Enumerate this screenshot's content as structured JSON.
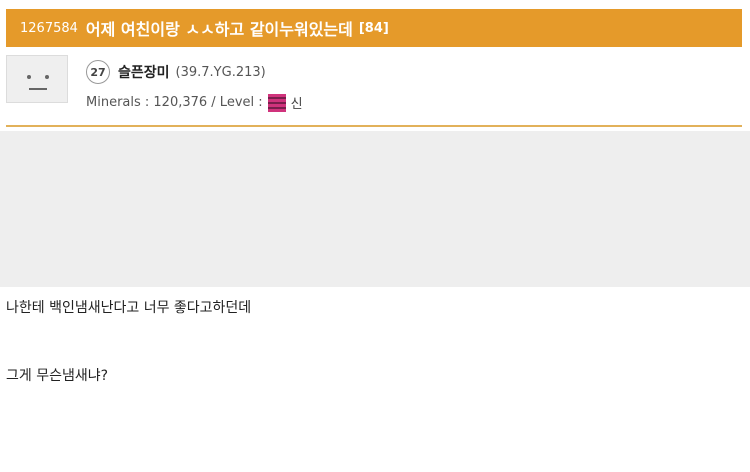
{
  "post": {
    "id": "1267584",
    "title": "어제 여친이랑 ㅅㅅ하고 같이누워있는데",
    "comment_count": "[84]"
  },
  "author": {
    "level_number": "27",
    "nickname": "슬픈장미",
    "ip": "(39.7.YG.213)",
    "minerals_label": "Minerals : 120,376 / Level :",
    "level_name": "신",
    "level_icon": "level-badge-icon",
    "level_icon_color": "#d0337c"
  },
  "content": {
    "lines": [
      "나한테 백인냄새난다고 너무 좋다고하던데",
      "그게 무슨냄새냐?"
    ]
  },
  "colors": {
    "title_bar": "#e59a2a",
    "divider": "#e2b15a",
    "image_placeholder": "#eeeeee"
  }
}
